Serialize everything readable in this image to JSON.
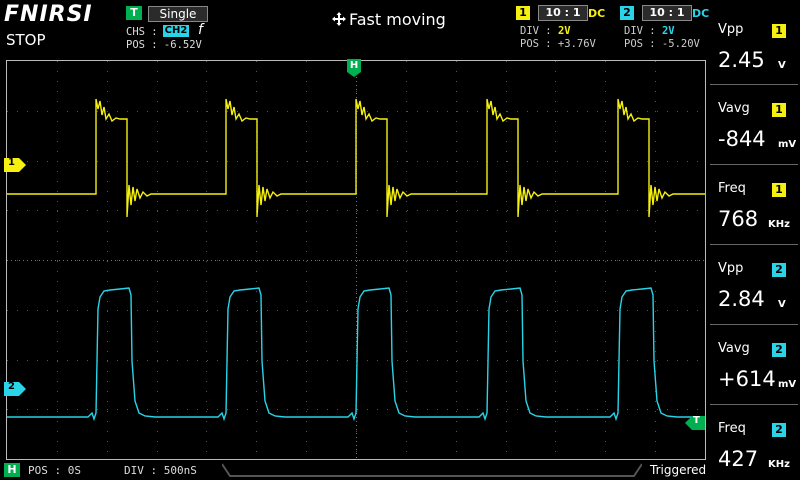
{
  "header": {
    "brand": "FNIRSI",
    "run_state": "STOP",
    "trigger_badge": "T",
    "trigger_mode": "Single",
    "chs_label": "CHS :",
    "chs_value": "CH2",
    "trigger_edge": "f",
    "trigger_pos": "POS : -6.52V",
    "move_mode": "Fast moving",
    "move_icon": "move-arrows-icon"
  },
  "ch1": {
    "label": "1",
    "probe": "10 : 1",
    "coupling": "DC",
    "div_label": "DIV :",
    "div_value": "2V",
    "pos": "POS : +3.76V",
    "color": "#f5f010"
  },
  "ch2": {
    "label": "2",
    "probe": "10 : 1",
    "coupling": "DC",
    "div_label": "DIV :",
    "div_value": "2V",
    "pos": "POS : -5.20V",
    "color": "#29d4e8"
  },
  "markers": {
    "h": "H",
    "ch1": "1",
    "ch2": "2",
    "trigger": "T"
  },
  "measurements": [
    {
      "name": "Vpp",
      "channel": "1",
      "value": "2.45",
      "unit": "V",
      "color": "#f5f010"
    },
    {
      "name": "Vavg",
      "channel": "1",
      "value": "-844",
      "unit": "mV",
      "color": "#f5f010"
    },
    {
      "name": "Freq",
      "channel": "1",
      "value": "768",
      "unit": "KHz",
      "color": "#f5f010"
    },
    {
      "name": "Vpp",
      "channel": "2",
      "value": "2.84",
      "unit": "V",
      "color": "#29d4e8"
    },
    {
      "name": "Vavg",
      "channel": "2",
      "value": "+614",
      "unit": "mV",
      "color": "#29d4e8"
    },
    {
      "name": "Freq",
      "channel": "2",
      "value": "427",
      "unit": "KHz",
      "color": "#29d4e8"
    }
  ],
  "bottom": {
    "h_badge": "H",
    "pos": "POS : 0S",
    "div": "DIV : 500nS",
    "status": "Triggered"
  }
}
